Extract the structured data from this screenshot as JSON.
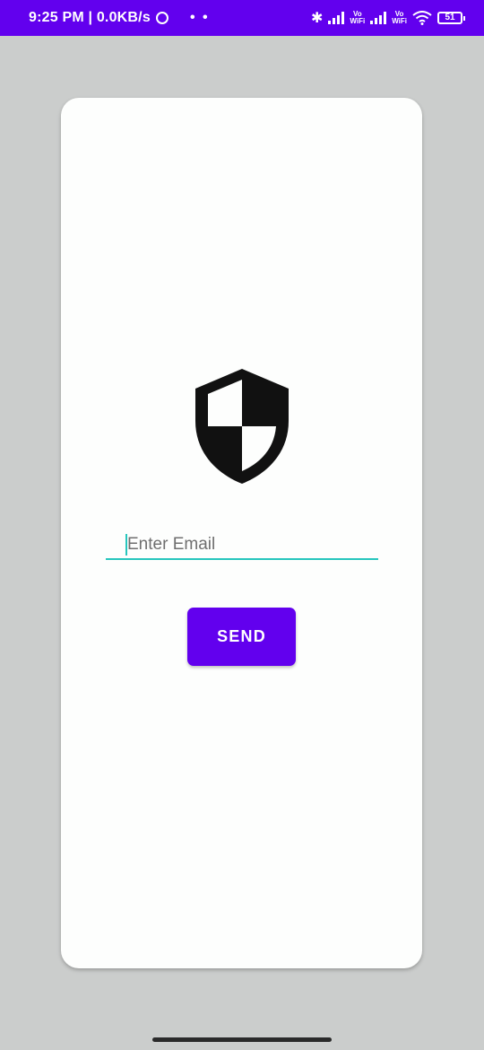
{
  "status_bar": {
    "time_speed": "9:25 PM | 0.0KB/s",
    "dots": "• •",
    "vo_wifi_top": "Vo",
    "vo_wifi_bottom": "WiFi",
    "battery": "51",
    "bluetooth_glyph": "✱"
  },
  "shield_icon": "security-shield-icon",
  "email": {
    "placeholder": "Enter Email",
    "value": ""
  },
  "send_button": {
    "label": "SEND"
  },
  "colors": {
    "primary": "#6200ee",
    "accent": "#26c6bd",
    "background": "#cbcdcc",
    "card": "#fdfefd"
  }
}
